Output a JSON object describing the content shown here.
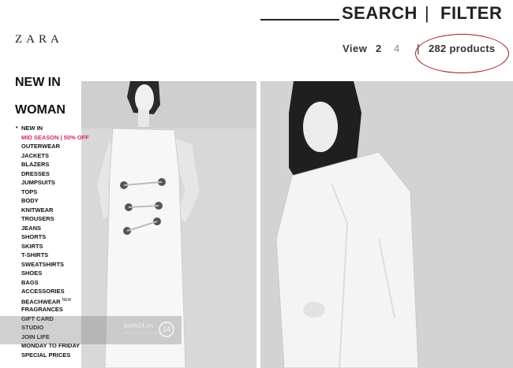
{
  "brand": {
    "logo_text": "ZARA"
  },
  "header": {
    "search_label": "SEARCH",
    "separator": "|",
    "filter_label": "FILTER",
    "view_label": "View",
    "view_options": [
      "2",
      "4"
    ],
    "selected_view": "2",
    "product_count": "282 products",
    "highlight_color": "#9b1c1c"
  },
  "sidebar": {
    "section_title": "NEW IN",
    "category_title": "WOMAN",
    "sale_color": "#d6276b",
    "items": [
      {
        "label": "NEW IN",
        "state": "active"
      },
      {
        "label": "MID SEASON | 50% OFF",
        "state": "sale"
      },
      {
        "label": "OUTERWEAR"
      },
      {
        "label": "JACKETS"
      },
      {
        "label": "BLAZERS"
      },
      {
        "label": "DRESSES"
      },
      {
        "label": "JUMPSUITS"
      },
      {
        "label": "TOPS"
      },
      {
        "label": "BODY"
      },
      {
        "label": "KNITWEAR"
      },
      {
        "label": "TROUSERS"
      },
      {
        "label": "JEANS"
      },
      {
        "label": "SHORTS"
      },
      {
        "label": "SKIRTS"
      },
      {
        "label": "T-SHIRTS"
      },
      {
        "label": "SWEATSHIRTS"
      },
      {
        "label": "SHOES"
      },
      {
        "label": "BAGS"
      },
      {
        "label": "ACCESSORIES"
      },
      {
        "label": "BEACHWEAR",
        "badge": "NEW"
      },
      {
        "label": "FRAGRANCES"
      },
      {
        "label": "GIFT CARD"
      },
      {
        "label": "STUDIO"
      },
      {
        "label": "JOIN LIFE"
      },
      {
        "label": "MONDAY TO FRIDAY"
      },
      {
        "label": "SPECIAL PRICES"
      }
    ]
  },
  "products": [
    {
      "image_icon": "model-white-dress-photo"
    },
    {
      "image_icon": "model-white-shirt-photo"
    }
  ],
  "watermark": {
    "site": "kenh14.vn",
    "logo": "14",
    "subtext": "KÊNH GIẢI TRÍ - XÃ HỘI"
  }
}
